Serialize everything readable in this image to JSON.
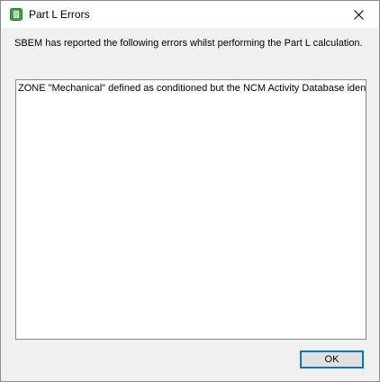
{
  "window": {
    "title": "Part L Errors",
    "icon": "sbem-app-icon",
    "close_icon": "close-icon"
  },
  "message": "SBEM has reported the following errors whilst performing the Part L calculation.",
  "errors": [
    "ZONE \"Mechanical\" defined as conditioned but the NCM Activity Database identi"
  ],
  "buttons": {
    "ok_label": "OK"
  },
  "colors": {
    "accent": "#0078d7",
    "icon_green": "#3aa341"
  }
}
